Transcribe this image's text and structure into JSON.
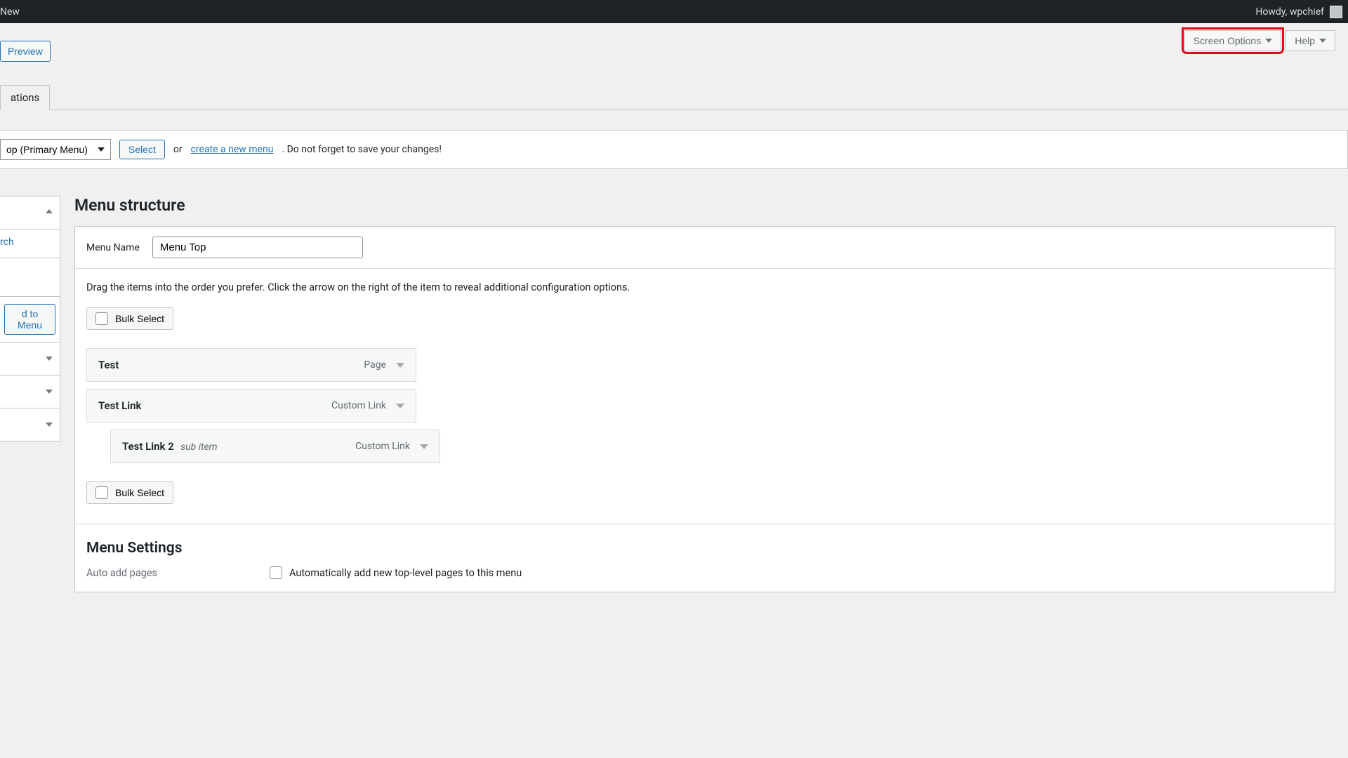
{
  "adminbar": {
    "left_trailing": "New",
    "howdy": "Howdy, wpchief"
  },
  "top_controls": {
    "screen_options": "Screen Options",
    "help": "Help"
  },
  "preview_btn": "Preview",
  "nav_tab_trailing": "ations",
  "menuselect": {
    "dropdown_value": "op (Primary Menu)",
    "select_btn": "Select",
    "or": "or",
    "create_link": "create a new menu",
    "suffix": ". Do not forget to save your changes!"
  },
  "sidebar": {
    "search_tab": "rch",
    "add_to_menu": "d to Menu"
  },
  "structure": {
    "heading": "Menu structure",
    "menu_name_label": "Menu Name",
    "menu_name_value": "Menu Top",
    "instructions": "Drag the items into the order you prefer. Click the arrow on the right of the item to reveal additional configuration options.",
    "bulk_select": "Bulk Select",
    "items": [
      {
        "title": "Test",
        "type": "Page",
        "indent": 0
      },
      {
        "title": "Test Link",
        "type": "Custom Link",
        "indent": 0
      },
      {
        "title": "Test Link 2",
        "type": "Custom Link",
        "indent": 1,
        "sub": "sub item"
      }
    ]
  },
  "settings": {
    "heading": "Menu Settings",
    "auto_add_label": "Auto add pages",
    "auto_add_checkbox": "Automatically add new top-level pages to this menu"
  }
}
